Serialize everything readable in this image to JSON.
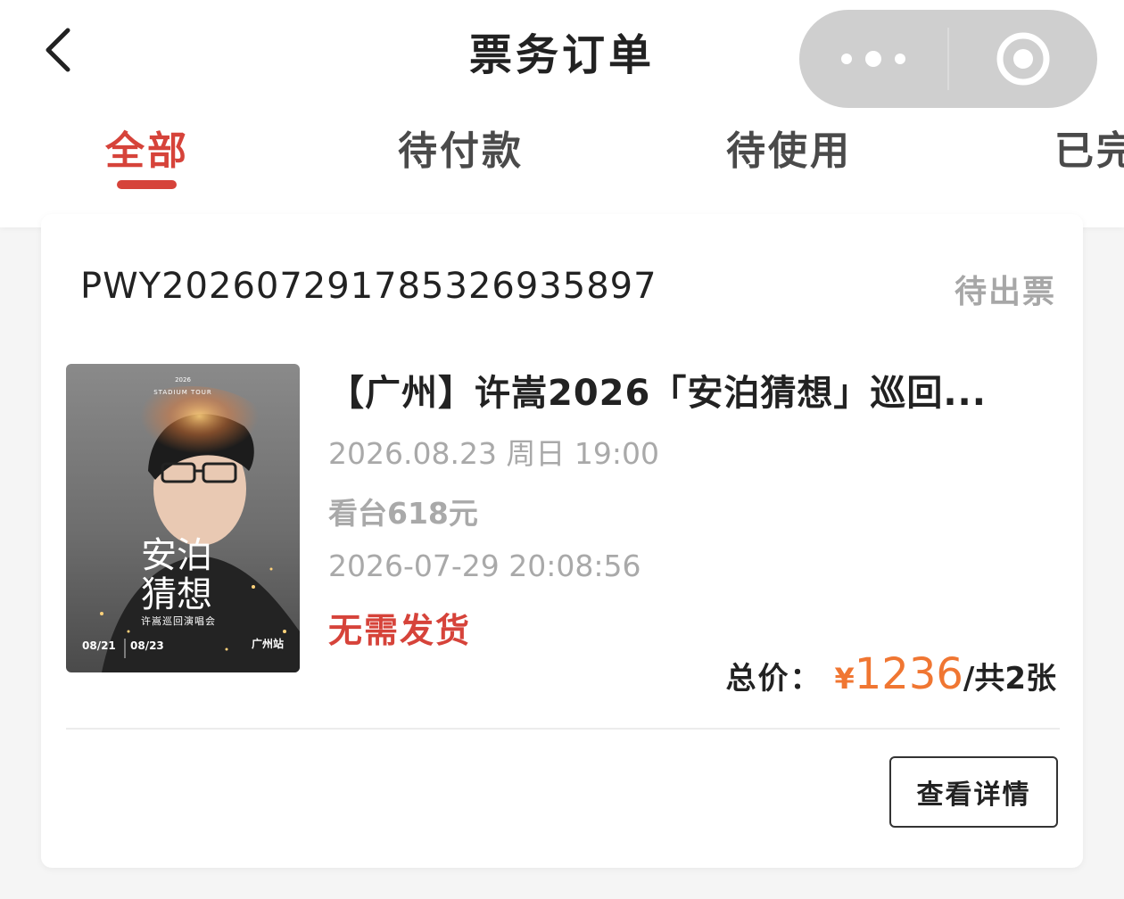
{
  "header": {
    "title": "票务订单",
    "back_icon": "chevron-left-icon",
    "more_icon": "more-dots-icon",
    "close_icon": "target-circle-icon"
  },
  "tabs": [
    {
      "label": "全部",
      "active": true
    },
    {
      "label": "待付款",
      "active": false
    },
    {
      "label": "待使用",
      "active": false
    },
    {
      "label": "已完",
      "active": false
    }
  ],
  "order": {
    "order_no": "PWY20260729178532​6935897",
    "status": "待出票",
    "poster": {
      "year": "2026",
      "tour": "STADIUM TOUR",
      "title_line1": "安泊",
      "title_line2": "猜想",
      "subtitle": "许嵩巡回演唱会",
      "date1": "08/21",
      "date2": "08/23",
      "station": "广州站"
    },
    "event_title": "【广州】许嵩2026「安泊猜想」巡回...",
    "show_time": "2026.08.23 周日 19:00",
    "ticket_tier": "看台618元",
    "order_time": "2026-07-29 20:08:56",
    "delivery": "无需发货",
    "total_label": "总价：",
    "currency": "¥",
    "amount": "1236",
    "count": "/共2张",
    "detail_button": "查看详情"
  },
  "colors": {
    "accent": "#d6433a",
    "price": "#f07632",
    "muted": "#a9a9a9"
  }
}
